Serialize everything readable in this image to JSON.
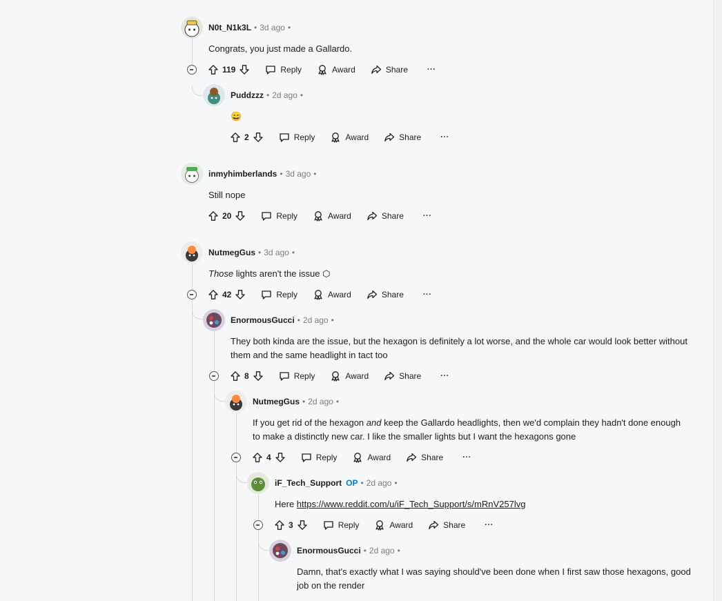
{
  "actions": {
    "reply": "Reply",
    "award": "Award",
    "share": "Share",
    "more": "···"
  },
  "comments": [
    {
      "user": "N0t_N1k3L",
      "time": "3d ago",
      "text": "Congrats, you just made a Gallardo.",
      "score": "119"
    },
    {
      "user": "Puddzzz",
      "time": "2d ago",
      "text": "😄",
      "score": "2"
    },
    {
      "user": "inmyhimberlands",
      "time": "3d ago",
      "text": "Still nope",
      "score": "20"
    },
    {
      "user": "NutmegGus",
      "time": "3d ago",
      "text_em": "Those",
      "text": " lights aren't the issue ⬡",
      "score": "42"
    },
    {
      "user": "EnormousGucci",
      "time": "2d ago",
      "text": "They both kinda are the issue, but the hexagon is definitely a lot worse, and the whole car would look better without them and the same headlight in tact too",
      "score": "8"
    },
    {
      "user": "NutmegGus",
      "time": "2d ago",
      "text_pre": "If you get rid of the hexagon ",
      "text_em": "and",
      "text": " keep the Gallardo headlights, then we'd complain they hadn't done enough to make a distinctly new car. I like the smaller lights but I want the hexagons gone",
      "score": "4"
    },
    {
      "user": "iF_Tech_Support",
      "op": "OP",
      "time": "2d ago",
      "text_pre": "Here ",
      "link": "https://www.reddit.com/u/iF_Tech_Support/s/mRnV257lvg",
      "score": "3"
    },
    {
      "user": "EnormousGucci",
      "time": "2d ago",
      "text": "Damn, that's exactly what I was saying should've been done when I first saw those hexagons, good job on the render"
    }
  ]
}
